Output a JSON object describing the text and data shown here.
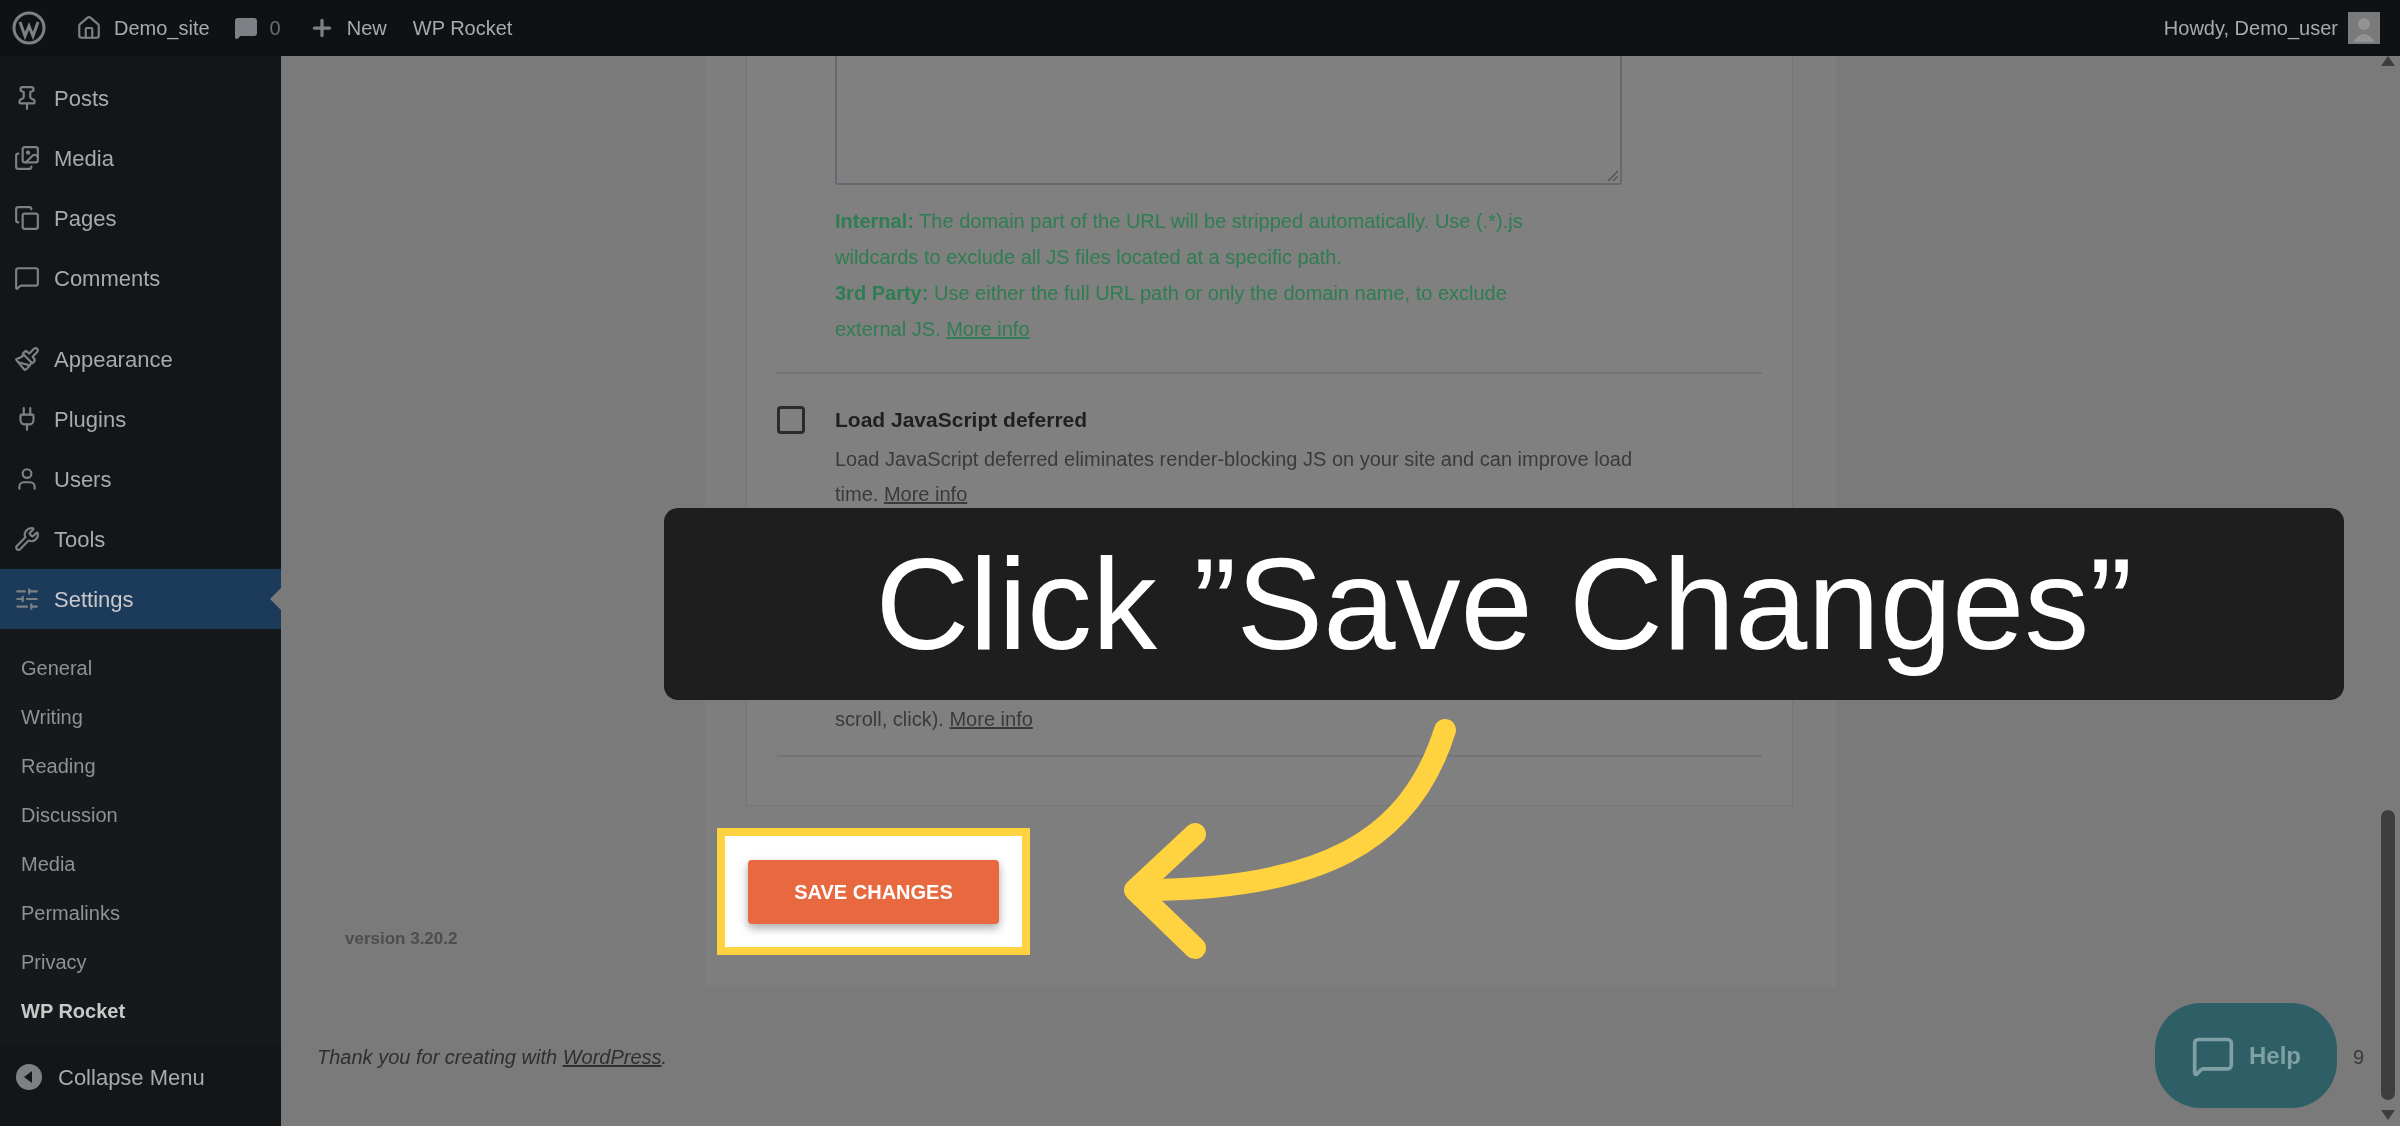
{
  "top_bar": {
    "site_name": "Demo_site",
    "comments_count": "0",
    "new_label": "New",
    "plugin_label": "WP Rocket",
    "greeting": "Howdy, Demo_user"
  },
  "sidebar": {
    "groups": [
      [
        {
          "label": "Posts",
          "selected": false
        },
        {
          "label": "Media",
          "selected": false
        },
        {
          "label": "Pages",
          "selected": false
        },
        {
          "label": "Comments",
          "selected": false
        }
      ],
      [
        {
          "label": "Appearance",
          "selected": false
        },
        {
          "label": "Plugins",
          "selected": false
        },
        {
          "label": "Users",
          "selected": false
        },
        {
          "label": "Tools",
          "selected": false
        },
        {
          "label": "Settings",
          "selected": true
        }
      ]
    ],
    "submenu": [
      {
        "label": "General",
        "selected": false
      },
      {
        "label": "Writing",
        "selected": false
      },
      {
        "label": "Reading",
        "selected": false
      },
      {
        "label": "Discussion",
        "selected": false
      },
      {
        "label": "Media",
        "selected": false
      },
      {
        "label": "Permalinks",
        "selected": false
      },
      {
        "label": "Privacy",
        "selected": false
      },
      {
        "label": "WP Rocket",
        "selected": true
      }
    ],
    "collapse_label": "Collapse Menu"
  },
  "content": {
    "help_lines": [
      {
        "label": "Internal:",
        "text": "The domain part of the URL will be stripped automatically. Use (.*).js wildcards to exclude all JS files located at a specific path."
      },
      {
        "label": "3rd Party:",
        "text": "Use either the full URL path or only the domain name, to exclude external JS.",
        "link": "More info"
      }
    ],
    "options": [
      {
        "kind": "checkbox",
        "title": "Load JavaScript deferred",
        "checked": false,
        "description": "Load JavaScript deferred eliminates render-blocking JS on your site and can improve load time.",
        "link": "More info"
      },
      {
        "kind": "text",
        "description": "scroll, click).",
        "link": "More info"
      }
    ],
    "save_button": "SAVE CHANGES",
    "version": "version 3.20.2"
  },
  "footer": {
    "text": "Thank you for creating with",
    "link": "WordPress",
    "end": ".",
    "version_fragment": "9"
  },
  "help_button": "Help",
  "caption": "Click ”Save Changes”"
}
